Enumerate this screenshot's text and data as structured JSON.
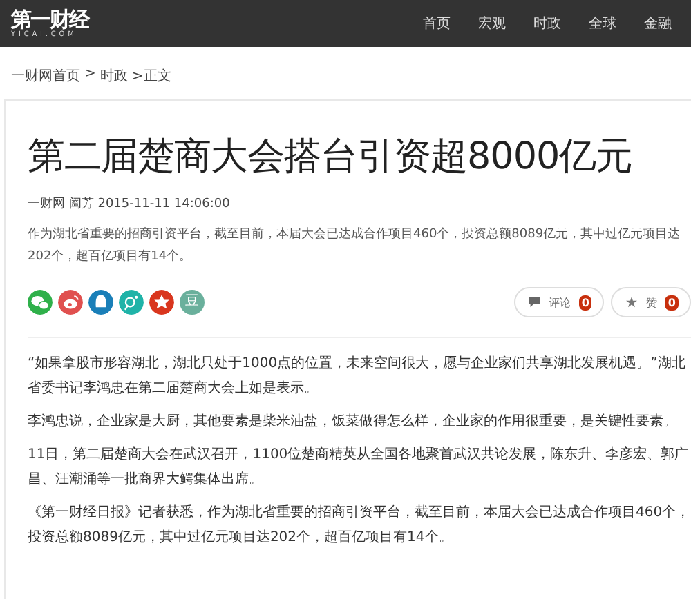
{
  "header": {
    "logo": "第一财经",
    "logo_sub": "YICAI.COM",
    "nav": [
      {
        "label": "首页"
      },
      {
        "label": "宏观"
      },
      {
        "label": "时政"
      },
      {
        "label": "全球"
      },
      {
        "label": "金融"
      }
    ]
  },
  "breadcrumb": [
    "一财网首页",
    ">",
    "时政",
    ">正文"
  ],
  "article": {
    "title": "第二届楚商大会搭台引资超8000亿元",
    "meta": "一财网 阖芳 2015-11-11 14:06:00",
    "summary": "作为湖北省重要的招商引资平台，截至目前，本届大会已达成合作项目460个，投资总额8089亿元，其中过亿元项目达202个，超百亿项目有14个。",
    "share": [
      {
        "kind": "wechat",
        "color": "#2fb04a"
      },
      {
        "kind": "weibo",
        "color": "#e0504f"
      },
      {
        "kind": "qq",
        "color": "#1a7fb8"
      },
      {
        "kind": "moments",
        "color": "#1fb3a8"
      },
      {
        "kind": "qzone",
        "color": "#d9361e"
      },
      {
        "kind": "douban",
        "color": "#6ab09c",
        "label": "豆"
      }
    ],
    "actions": [
      {
        "kind": "comment",
        "label": "评论",
        "count": "0"
      },
      {
        "kind": "like",
        "label": "赞",
        "count": "0"
      }
    ],
    "paragraphs": [
      "“如果拿股市形容湖北，湖北只处于1000点的位置，未来空间很大，愿与企业家们共享湖北发展机遇。”湖北省委书记李鸿忠在第二届楚商大会上如是表示。",
      "李鸿忠说，企业家是大厨，其他要素是柴米油盐，饭菜做得怎么样，企业家的作用很重要，是关键性要素。",
      "11日，第二届楚商大会在武汉召开，1100位楚商精英从全国各地聚首武汉共论发展，陈东升、李彦宏、郭广昌、汪潮涌等一批商界大鳄集体出席。",
      "《第一财经日报》记者获悉，作为湖北省重要的招商引资平台，截至目前，本届大会已达成合作项目460个，投资总额8089亿元，其中过亿元项目达202个，超百亿项目有14个。"
    ]
  }
}
